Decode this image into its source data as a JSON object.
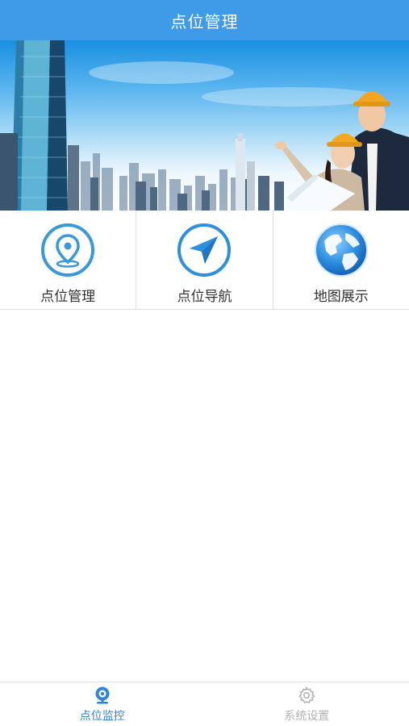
{
  "header": {
    "title": "点位管理"
  },
  "menu": {
    "items": [
      {
        "label": "点位管理",
        "icon": "location-pin-icon"
      },
      {
        "label": "点位导航",
        "icon": "navigation-arrow-icon"
      },
      {
        "label": "地图展示",
        "icon": "globe-map-icon"
      }
    ]
  },
  "tabs": [
    {
      "label": "点位监控",
      "icon": "camera-monitor-icon",
      "active": true
    },
    {
      "label": "系统设置",
      "icon": "gear-icon",
      "active": false
    }
  ],
  "colors": {
    "primary": "#3f9ae8",
    "accent": "#2f86d6",
    "inactive": "#b3b3b3"
  }
}
